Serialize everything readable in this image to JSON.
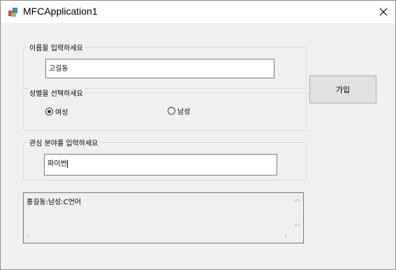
{
  "window": {
    "title": "MFCApplication1"
  },
  "name_group": {
    "label": "이름을 입력하세요",
    "value": "고길동"
  },
  "gender_group": {
    "label": "성별을 선택하세요",
    "options": [
      {
        "label": "여성",
        "checked": true
      },
      {
        "label": "남성",
        "checked": false
      }
    ]
  },
  "interest_group": {
    "label": "관심 분야를 입력하세요",
    "value": "파이썬"
  },
  "join_button": {
    "label": "가입"
  },
  "result_list": {
    "items": [
      "홍길동:남성:C언어"
    ]
  },
  "icons": [
    "app-icon",
    "close-icon",
    "scroll-up-icon",
    "scroll-down-icon",
    "scroll-left-icon",
    "scroll-right-icon"
  ]
}
